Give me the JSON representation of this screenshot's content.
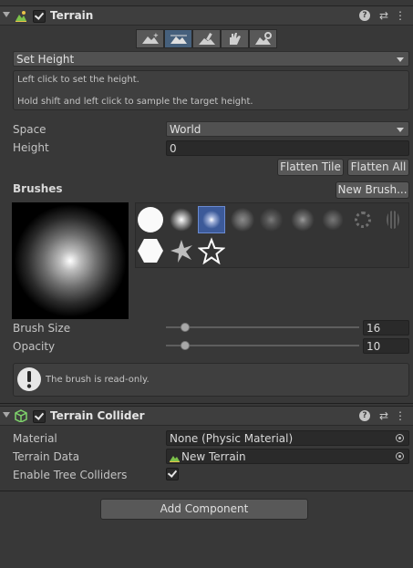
{
  "terrain": {
    "title": "Terrain",
    "mode_dropdown": "Set Height",
    "help_lines": [
      "Left click to set the height.",
      "Hold shift and left click to sample the target height."
    ],
    "space_label": "Space",
    "space_value": "World",
    "height_label": "Height",
    "height_value": "0",
    "flatten_tile": "Flatten Tile",
    "flatten_all": "Flatten All",
    "brushes_label": "Brushes",
    "new_brush": "New Brush...",
    "brush_size_label": "Brush Size",
    "brush_size_value": "16",
    "brush_size_fraction": 0.1,
    "opacity_label": "Opacity",
    "opacity_value": "10",
    "opacity_fraction": 0.1,
    "readonly_msg": "The brush is read-only."
  },
  "collider": {
    "title": "Terrain Collider",
    "material_label": "Material",
    "material_value": "None (Physic Material)",
    "terrain_data_label": "Terrain Data",
    "terrain_data_value": "New Terrain",
    "enable_tree_label": "Enable Tree Colliders"
  },
  "add_component": "Add Component",
  "colors": {
    "background": "#383838",
    "selected_tool": "#46607c",
    "selected_brush": "#3c5a99"
  }
}
